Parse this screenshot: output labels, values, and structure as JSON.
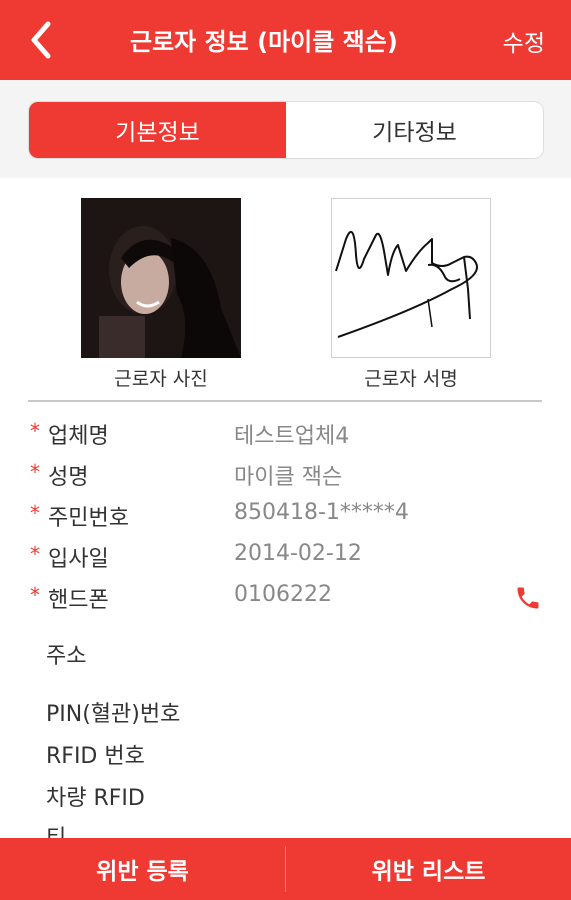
{
  "header": {
    "title": "근로자 정보 (마이클 잭슨)",
    "edit_label": "수정"
  },
  "tabs": [
    {
      "label": "기본정보",
      "active": true
    },
    {
      "label": "기타정보",
      "active": false
    }
  ],
  "media": {
    "photo_caption": "근로자 사진",
    "signature_caption": "근로자 서명"
  },
  "fields": [
    {
      "label": "업체명",
      "value": "테스트업체4",
      "required": "*"
    },
    {
      "label": "성명",
      "value": "마이클 잭슨",
      "required": "*"
    },
    {
      "label": "주민번호",
      "value": "850418-1*****4",
      "required": "*"
    },
    {
      "label": "입사일",
      "value": "2014-02-12",
      "required": "*"
    },
    {
      "label": "핸드폰",
      "value": "0106222",
      "required": "*"
    }
  ],
  "extra_fields": {
    "address": "주소",
    "pin": "PIN(혈관)번호",
    "rfid": "RFID 번호",
    "vehicle_rfid": "차량 RFID",
    "partial": "티"
  },
  "bottom": {
    "left_label": "위반 등록",
    "right_label": "위반 리스트"
  },
  "colors": {
    "accent": "#ee3a33"
  },
  "icons": {
    "back": "chevron-left-icon",
    "phone": "phone-icon"
  }
}
